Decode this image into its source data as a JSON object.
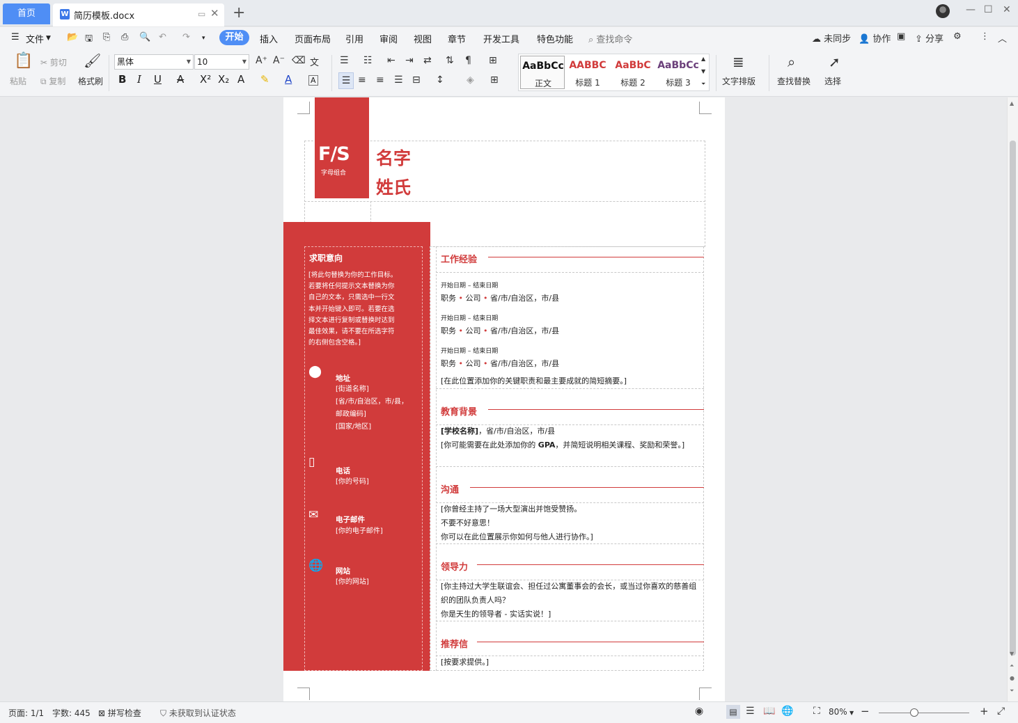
{
  "tabs": {
    "home": "首页",
    "doc_title": "简历模板.docx"
  },
  "menu": {
    "file": "文件",
    "items": [
      "开始",
      "插入",
      "页面布局",
      "引用",
      "审阅",
      "视图",
      "章节",
      "开发工具",
      "特色功能"
    ],
    "search": "查找命令",
    "sync": "未同步",
    "collab": "协作",
    "share": "分享"
  },
  "ribbon": {
    "paste": "粘贴",
    "cut": "剪切",
    "copy": "复制",
    "format_painter": "格式刷",
    "font_name": "黑体",
    "font_size": "10",
    "styles": [
      {
        "sample": "AaBbCc",
        "name": "正文",
        "color": "#111111"
      },
      {
        "sample": "AABBC",
        "name": "标题 1",
        "color": "#d13b3b"
      },
      {
        "sample": "AaBbC",
        "name": "标题 2",
        "color": "#d13b3b"
      },
      {
        "sample": "AaBbCc",
        "name": "标题 3",
        "color": "#6b3f7a"
      }
    ],
    "text_layout": "文字排版",
    "find_replace": "查找替换",
    "select": "选择"
  },
  "resume": {
    "logo": "F/S",
    "logo_sub": "字母组合",
    "first_name": "名字",
    "last_name": "姓氏",
    "objective_title": "求职意向",
    "objective_text": "[将此句替换为你的工作目标。若要将任何提示文本替换为你自己的文本，只需选中一行文本并开始键入即可。若要在选择文本进行复制或替换时达到最佳效果，请不要在所选字符的右侧包含空格。]",
    "address_label": "地址",
    "address_lines": [
      "[街道名称]",
      "[省/市/自治区，市/县，",
      "邮政编码]",
      "[国家/地区]"
    ],
    "phone_label": "电话",
    "phone_value": "[你的号码]",
    "email_label": "电子邮件",
    "email_value": "[你的电子邮件]",
    "website_label": "网站",
    "website_value": "[你的网站]",
    "work_title": "工作经验",
    "jobs": [
      {
        "date": "开始日期 – 结束日期",
        "role": "职务",
        "company": "公司",
        "location": "省/市/自治区，市/县"
      },
      {
        "date": "开始日期 – 结束日期",
        "role": "职务",
        "company": "公司",
        "location": "省/市/自治区，市/县"
      },
      {
        "date": "开始日期 – 结束日期",
        "role": "职务",
        "company": "公司",
        "location": "省/市/自治区，市/县"
      }
    ],
    "work_summary": "[在此位置添加你的关键职责和最主要成就的简短摘要。]",
    "edu_title": "教育背景",
    "edu_school": "[学校名称]",
    "edu_location": "，省/市/自治区，市/县",
    "edu_gpa_pre": "[你可能需要在此处添加你的 ",
    "edu_gpa": "GPA",
    "edu_gpa_post": "，并简短说明相关课程、奖励和荣誉。]",
    "comm_title": "沟通",
    "comm_lines": [
      "[你曾经主持了一场大型演出并饱受赞扬。",
      "不要不好意思！",
      "你可以在此位置展示你如何与他人进行协作。]"
    ],
    "lead_title": "领导力",
    "lead_lines": [
      "[你主持过大学生联谊会、担任过公寓董事会的会长，或当过你喜欢的慈善组织的团队负责人吗？",
      "你是天生的领导者 - 实话实说！]"
    ],
    "ref_title": "推荐信",
    "ref_text": "[按要求提供。]"
  },
  "status": {
    "page": "页面: 1/1",
    "words": "字数: 445",
    "spell": "拼写检查",
    "auth": "未获取到认证状态",
    "zoom": "80%"
  },
  "colors": {
    "accent": "#d13b3b",
    "tab_active": "#4f8ef5"
  }
}
